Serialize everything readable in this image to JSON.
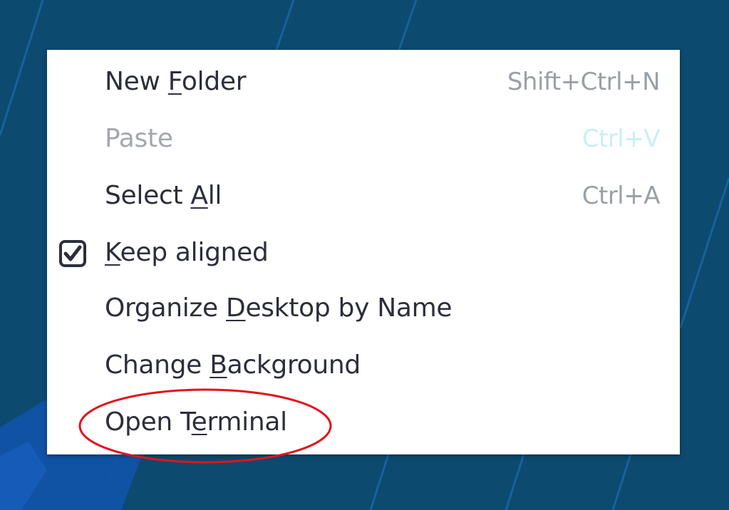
{
  "menu": {
    "items": [
      {
        "pre": "New ",
        "mn": "F",
        "post": "older",
        "shortcut": "Shift+Ctrl+N",
        "enabled": true
      },
      {
        "pre": "Paste",
        "mn": "",
        "post": "",
        "shortcut": "Ctrl+V",
        "enabled": false
      },
      {
        "pre": "Select ",
        "mn": "A",
        "post": "ll",
        "shortcut": "Ctrl+A",
        "enabled": true
      },
      {
        "pre": "",
        "mn": "K",
        "post": "eep aligned",
        "shortcut": "",
        "enabled": true,
        "checked": true
      },
      {
        "pre": "Organize ",
        "mn": "D",
        "post": "esktop by Name",
        "shortcut": "",
        "enabled": true
      },
      {
        "pre": "Change ",
        "mn": "B",
        "post": "ackground",
        "shortcut": "",
        "enabled": true
      },
      {
        "pre": "Open T",
        "mn": "e",
        "post": "rminal",
        "shortcut": "",
        "enabled": true
      }
    ]
  },
  "colors": {
    "desktop": "#0c4a70",
    "menu_bg": "#ffffff",
    "text": "#2c2e3b",
    "disabled_text": "#a4a8ad",
    "shortcut_text": "#9aa0a6",
    "annotation": "#e0141c"
  },
  "icons": {
    "checkbox": "checkbox-checked-icon"
  }
}
